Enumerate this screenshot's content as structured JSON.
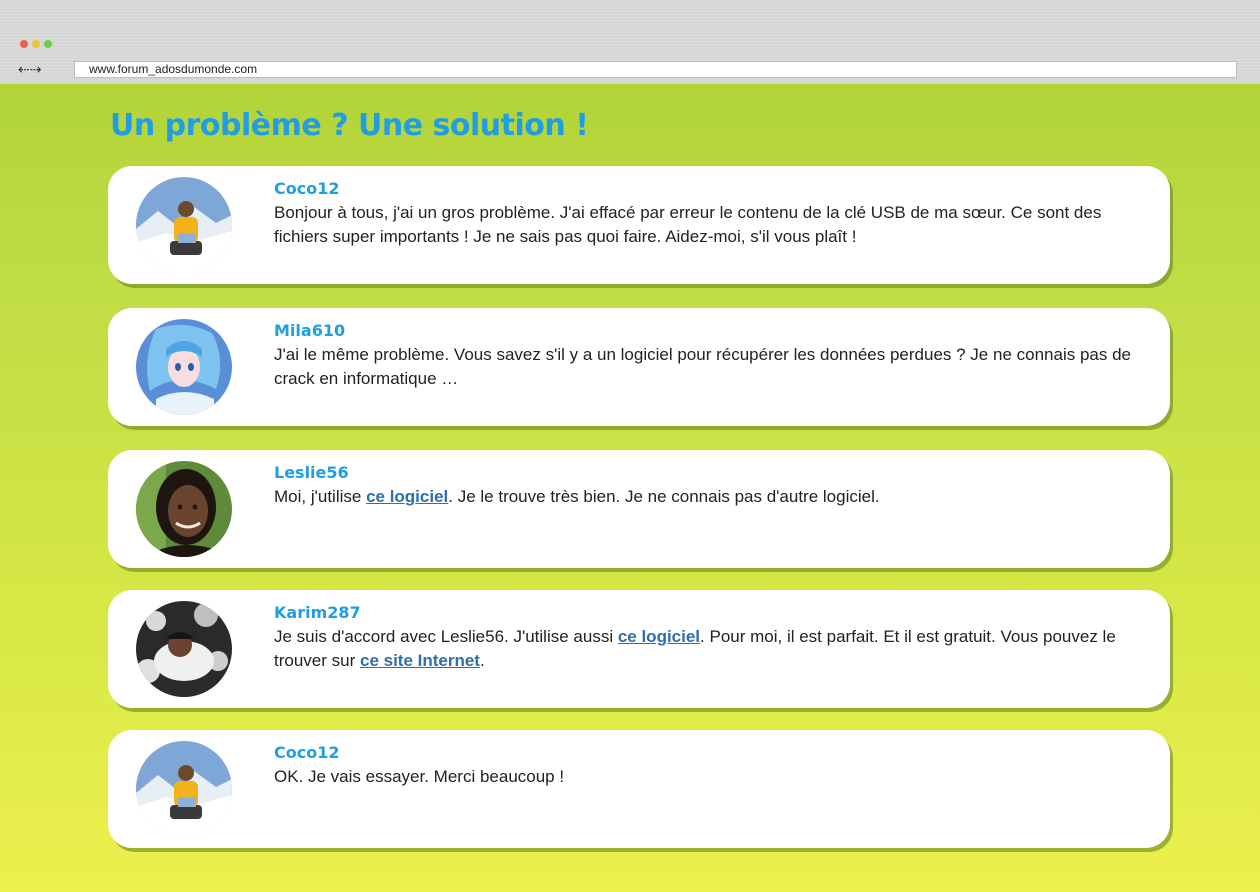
{
  "browser": {
    "nav_arrows": "⇠⇢",
    "url": "www.forum_adosdumonde.com"
  },
  "page": {
    "title": "Un problème ? Une solution !"
  },
  "posts": [
    {
      "username": "Coco12",
      "avatar_icon": "snowboarder-avatar",
      "text_parts": [
        "Bonjour à tous, j'ai un gros problème. J'ai effacé par erreur le contenu de la clé USB de ma sœur. Ce sont des fichiers super importants ! Je ne sais pas quoi faire. Aidez-moi, s'il vous plaît !"
      ]
    },
    {
      "username": "Mila610",
      "avatar_icon": "anime-girl-avatar",
      "text_parts": [
        "J'ai le même problème. Vous savez s'il y a un logiciel pour récupérer les données perdues ? Je ne connais pas de crack en informatique …"
      ]
    },
    {
      "username": "Leslie56",
      "avatar_icon": "girl-portrait-avatar",
      "text_parts": [
        "Moi, j'utilise ",
        "ce logiciel",
        ". Je le trouve très bien. Je ne connais pas d'autre logiciel."
      ]
    },
    {
      "username": "Karim287",
      "avatar_icon": "boy-snow-avatar",
      "text_parts": [
        "Je suis d'accord avec Leslie56. J'utilise aussi ",
        "ce logiciel",
        ". Pour moi, il est parfait. Et il est gratuit. Vous pouvez le trouver sur ",
        "ce site Internet",
        "."
      ]
    },
    {
      "username": "Coco12",
      "avatar_icon": "snowboarder-avatar",
      "text_parts": [
        "OK. Je vais essayer. Merci beaucoup !"
      ]
    }
  ],
  "colors": {
    "title": "#1f9ee6",
    "username": "#1f9ee6",
    "link": "#2d6fb3",
    "page_background_top": "#b2d438",
    "page_background_bottom": "#ecf04d"
  }
}
